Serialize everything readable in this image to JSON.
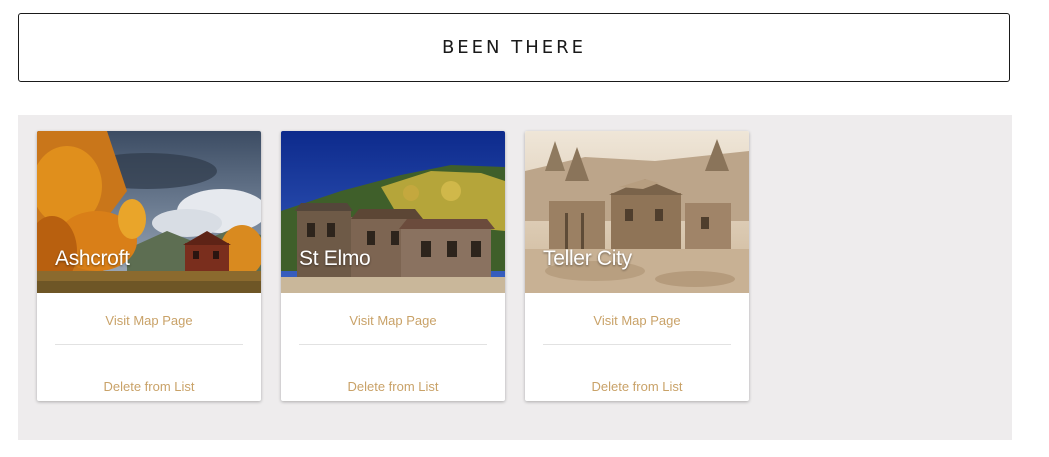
{
  "header": {
    "title": "BEEN THERE"
  },
  "cards": [
    {
      "name": "Ashcroft",
      "visit_label": "Visit Map Page",
      "delete_label": "Delete from List",
      "image": "autumn-aspens-ghost-town-photo"
    },
    {
      "name": "St Elmo",
      "visit_label": "Visit Map Page",
      "delete_label": "Delete from List",
      "image": "wooden-buildings-mountain-photo"
    },
    {
      "name": "Teller City",
      "visit_label": "Visit Map Page",
      "delete_label": "Delete from List",
      "image": "sepia-historic-cabins-photo"
    }
  ],
  "colors": {
    "accent": "#c9a268",
    "gallery_background": "#eeeced",
    "header_border": "#1a1a1a"
  }
}
